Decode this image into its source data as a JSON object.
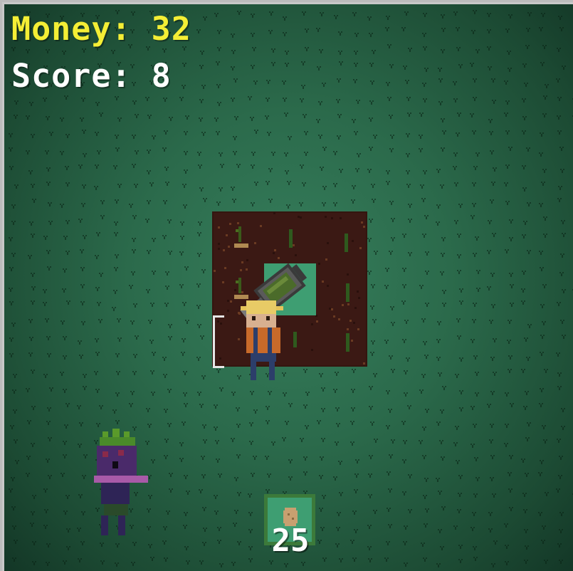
{
  "hud": {
    "money_label": "Money: 32",
    "score_label": "Score: 8",
    "money_color": "#f4ee35",
    "score_color": "#ffffff"
  },
  "hotbar": {
    "selected_item": "potato-seed-icon",
    "count": "25",
    "slot_border_color": "#3c7a3a",
    "slot_fill_color": "#3e9e72"
  },
  "scene": {
    "grass_color": "#2b6a4b",
    "soil_color": "#3b1914",
    "entities": [
      "farmer-player",
      "eggplant-monster-enemy",
      "watering-can-tool",
      "seedling-crop"
    ]
  }
}
